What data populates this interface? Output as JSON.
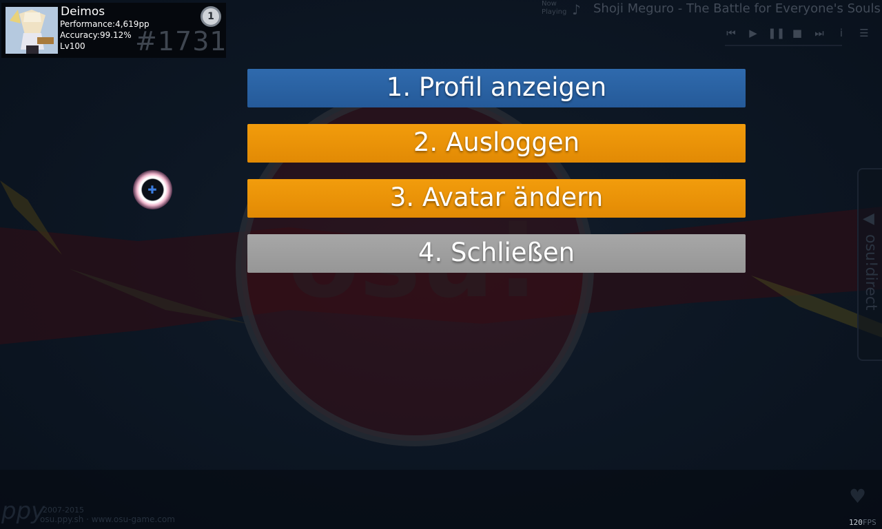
{
  "user_panel": {
    "username": "Deimos",
    "performance": "Performance:4,619pp",
    "accuracy": "Accuracy:99.12%",
    "level": "Lv100",
    "rank": "#1731",
    "mode_badge": "1"
  },
  "now_playing": {
    "label": "Now Playing",
    "title": "Shoji Meguro - The Battle for Everyone's Souls",
    "controls": [
      "previous-icon",
      "play-icon",
      "pause-icon",
      "stop-icon",
      "next-icon",
      "info-icon",
      "menu-icon"
    ]
  },
  "menu": {
    "items": [
      {
        "label": "1. Profil anzeigen",
        "color": "#2a62a3"
      },
      {
        "label": "2. Ausloggen",
        "color": "#ec9308"
      },
      {
        "label": "3. Avatar ändern",
        "color": "#ec9308"
      },
      {
        "label": "4. Schließen",
        "color": "#9f9f9f"
      }
    ]
  },
  "background": {
    "logo_text": "osu!",
    "logo_color": "#3c1016"
  },
  "side_tab": {
    "label": "osu!direct"
  },
  "footer": {
    "brand": "ppy",
    "years": "2007-2015",
    "links": "osu.ppy.sh · www.osu-game.com",
    "fps_value": "120",
    "fps_unit": "FPS"
  }
}
